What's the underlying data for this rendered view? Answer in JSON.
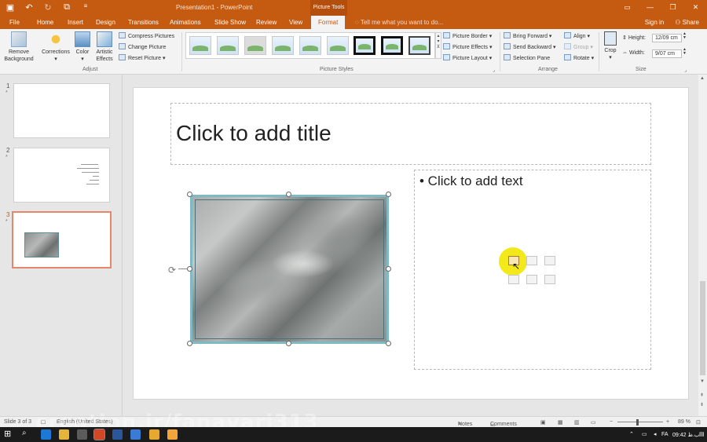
{
  "titlebar": {
    "title": "Presentation1 - PowerPoint",
    "context_tab": "Picture Tools",
    "qat": [
      "save-icon",
      "undo-icon",
      "redo-icon",
      "present-icon",
      "customize-icon"
    ],
    "brand_color": "#c55a11"
  },
  "tabs": {
    "items": [
      "File",
      "Home",
      "Insert",
      "Design",
      "Transitions",
      "Animations",
      "Slide Show",
      "Review",
      "View",
      "Format"
    ],
    "active": "Format",
    "tell_me": "Tell me what you want to do...",
    "sign_in": "Sign in",
    "share": "Share"
  },
  "ribbon": {
    "adjust": {
      "remove_background": "Remove Background",
      "corrections": "Corrections",
      "color": "Color",
      "artistic": "Artistic Effects",
      "compress": "Compress Pictures",
      "change": "Change Picture",
      "reset": "Reset Picture",
      "label": "Adjust"
    },
    "styles": {
      "label": "Picture Styles"
    },
    "picture_options": {
      "border": "Picture Border",
      "effects": "Picture Effects",
      "layout": "Picture Layout"
    },
    "arrange": {
      "bring_forward": "Bring Forward",
      "send_backward": "Send Backward",
      "selection_pane": "Selection Pane",
      "align": "Align",
      "group": "Group",
      "rotate": "Rotate",
      "label": "Arrange"
    },
    "size": {
      "crop": "Crop",
      "height_label": "Height:",
      "height_value": "12/09 cm",
      "width_label": "Width:",
      "width_value": "9/07 cm",
      "label": "Size"
    }
  },
  "thumbnails": {
    "numbers": [
      "1",
      "2",
      "3"
    ],
    "active_index": 3
  },
  "slide": {
    "title_placeholder": "Click to add title",
    "body_placeholder": "• Click to add text"
  },
  "statusbar": {
    "slide_info": "Slide 3 of 3",
    "language": "English (United States)",
    "notes": "Notes",
    "comments": "Comments",
    "zoom": "89 %"
  },
  "taskbar": {
    "clock": "09:42 ب.ظ",
    "lang": "FA"
  },
  "watermark": "creation.ir/fanavari313"
}
